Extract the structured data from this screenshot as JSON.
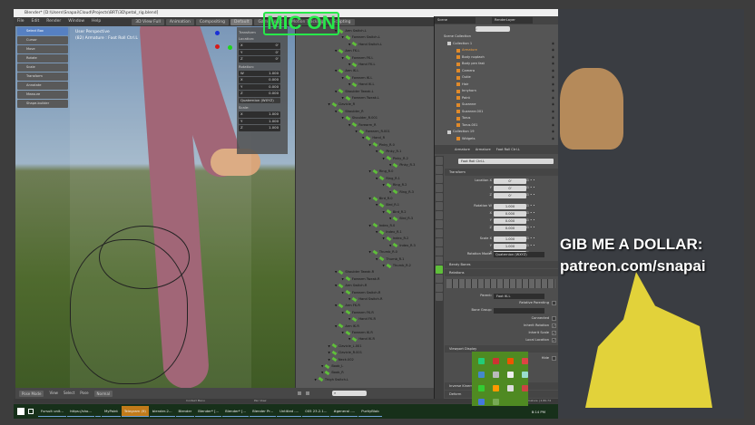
{
  "window": {
    "title": "Blender* [D:\\Users\\Snapai\\Cloud\\Projects\\BRT\\3D\\petal_rig.blend]"
  },
  "menu": [
    "File",
    "Edit",
    "Render",
    "Window",
    "Help"
  ],
  "workspaces": [
    "3D View Full",
    "Animation",
    "Compositing",
    "Default",
    "Game Logic",
    "Motion Tracking",
    "Scripting"
  ],
  "overlay": {
    "mic": "MIC ON",
    "promo_line1": "GIB ME A DOLLAR:",
    "promo_line2": "patreon.com/snapai"
  },
  "viewport": {
    "view_name": "User Perspective",
    "object_info": "(82) Armature : Foot Roll Ctrl.L",
    "tools": [
      "Select Box",
      "Cursor",
      "Move",
      "Rotate",
      "Scale",
      "Transform",
      "Annotate",
      "Measure",
      "Shape-builder"
    ],
    "npanel": {
      "header": "Transform",
      "location_label": "Location:",
      "location": [
        {
          "axis": "X",
          "value": "0'"
        },
        {
          "axis": "Y",
          "value": "0'"
        },
        {
          "axis": "Z",
          "value": "0'"
        }
      ],
      "rotation_label": "Rotation:",
      "rotation": [
        {
          "axis": "W",
          "value": "1.000"
        },
        {
          "axis": "X",
          "value": "0.000"
        },
        {
          "axis": "Y",
          "value": "0.000"
        },
        {
          "axis": "Z",
          "value": "0.000"
        }
      ],
      "rotation_mode": "Quaternion (WXYZ)",
      "scale_label": "Scale:",
      "scale": [
        {
          "axis": "X",
          "value": "1.000"
        },
        {
          "axis": "Y",
          "value": "1.000"
        },
        {
          "axis": "Z",
          "value": "1.000"
        }
      ]
    },
    "header": {
      "mode": "Pose Mode",
      "menus": [
        "View",
        "Select",
        "Pose"
      ],
      "orientation": "Normal"
    }
  },
  "outliner": {
    "bones": [
      [
        "Arm Switch.L",
        2
      ],
      [
        "Forearm Switch.L",
        3
      ],
      [
        "Hand Switch.L",
        4
      ],
      [
        "Arm FK.L",
        2
      ],
      [
        "Forearm FK.L",
        3
      ],
      [
        "Hand FK.L",
        4
      ],
      [
        "Arm IK.L",
        2
      ],
      [
        "Forearm IK.L",
        3
      ],
      [
        "Hand IK.L",
        4
      ],
      [
        "Shoulder Tweak.L",
        2
      ],
      [
        "Forearm Tweak.L",
        3
      ],
      [
        "Clavicle_R",
        1
      ],
      [
        "Shoulder_R",
        2
      ],
      [
        "Shoulder_R.001",
        3
      ],
      [
        "Forearm_R",
        4
      ],
      [
        "Forearm_R.001",
        5
      ],
      [
        "Hand_R",
        6
      ],
      [
        "Pinky_R.0",
        7
      ],
      [
        "Pinky_R.1",
        8
      ],
      [
        "Pinky_R.2",
        9
      ],
      [
        "Pinky_R.3",
        10
      ],
      [
        "Ring_R.0",
        7
      ],
      [
        "Ring_R.1",
        8
      ],
      [
        "Ring_R.2",
        9
      ],
      [
        "Ring_R.3",
        10
      ],
      [
        "Bird_R.0",
        7
      ],
      [
        "Bird_R.1",
        8
      ],
      [
        "Bird_R.2",
        9
      ],
      [
        "Bird_R.3",
        10
      ],
      [
        "Index_R.0",
        7
      ],
      [
        "Index_R.1",
        8
      ],
      [
        "Index_R.2",
        9
      ],
      [
        "Index_R.3",
        10
      ],
      [
        "Thumb_R.0",
        7
      ],
      [
        "Thumb_R.1",
        8
      ],
      [
        "Thumb_R.2",
        9
      ],
      [
        "Shoulder Tweak.R",
        2
      ],
      [
        "Forearm Tweak.R",
        3
      ],
      [
        "Arm Switch.R",
        2
      ],
      [
        "Forearm Switch.R",
        3
      ],
      [
        "Hand Switch.R",
        4
      ],
      [
        "Arm FK.R",
        2
      ],
      [
        "Forearm FK.R",
        3
      ],
      [
        "Hand FK.R",
        4
      ],
      [
        "Arm IK.R",
        2
      ],
      [
        "Forearm IK.R",
        3
      ],
      [
        "Hand IK.R",
        4
      ],
      [
        "Clavicle_L.001",
        1
      ],
      [
        "Clavicle_R.001",
        1
      ],
      [
        "Neck.002",
        1
      ],
      [
        "Boob_L",
        0
      ],
      [
        "Boob_R",
        0
      ],
      [
        "Thigh Switch.L",
        -1
      ]
    ]
  },
  "scene": {
    "scene_name": "Scene",
    "layer_name": "RenderLayer",
    "root": "Scene Collection",
    "items": [
      [
        "Collection 1",
        1
      ],
      [
        "Armature",
        2
      ],
      [
        "Body noptach",
        2
      ],
      [
        "Body pen fast",
        2
      ],
      [
        "Camera",
        2
      ],
      [
        "Outie",
        2
      ],
      [
        "Hair",
        2
      ],
      [
        "Innyhorn",
        2
      ],
      [
        "Paint",
        2
      ],
      [
        "Suzanne",
        2
      ],
      [
        "Suzanne.001",
        2
      ],
      [
        "Torus",
        2
      ],
      [
        "Torus.001",
        2
      ],
      [
        "Collection 19",
        1
      ],
      [
        "Widgets",
        2
      ]
    ]
  },
  "properties": {
    "breadcrumb": [
      "Armature",
      "Armature",
      "Foot Roll Ctrl.L"
    ],
    "bone_name": "Foot Roll Ctrl.L",
    "transform_header": "Transform",
    "rows": [
      [
        "Location X",
        "0'"
      ],
      [
        "Y",
        "0'"
      ],
      [
        "Z",
        "0'"
      ],
      [
        "Rotation W",
        "1.000"
      ],
      [
        "X",
        "0.000"
      ],
      [
        "Y",
        "0.000"
      ],
      [
        "Z",
        "0.000"
      ],
      [
        "Scale X",
        "1.000"
      ],
      [
        "Y",
        "1.000"
      ],
      [
        "Z",
        "1.000"
      ]
    ],
    "rotation_mode_label": "Rotation Mode:",
    "rotation_mode": "Quaternion (WXYZ)",
    "sections": [
      "Bendy Bones",
      "Relations",
      "Viewport Display",
      "Inverse Kinematics",
      "Deform"
    ],
    "parent_label": "Parent:",
    "parent": "Foot IK.L",
    "relative_parenting": "Relative Parenting",
    "bone_group_label": "Bone Group:",
    "checks": [
      "Connected",
      "Inherit Rotation",
      "Inherit Scale",
      "Local Location"
    ],
    "hide_label": "Hide"
  },
  "status": {
    "left": "Pan View",
    "mid": "Context Menu",
    "right": "Armature | 2.80.74"
  },
  "taskbar": {
    "tasks": [
      "Fursuit unit...",
      "https://sho...",
      "",
      "MyPaint",
      "Telegram (9)",
      "blender-2...",
      "Blender",
      "Blender* [...",
      "Blender* [...",
      "Blender Pr...",
      "Untitled -...",
      "005 23.2.1...",
      "#general -...",
      "PurityBlob"
    ],
    "clock": "8:14 PM"
  }
}
